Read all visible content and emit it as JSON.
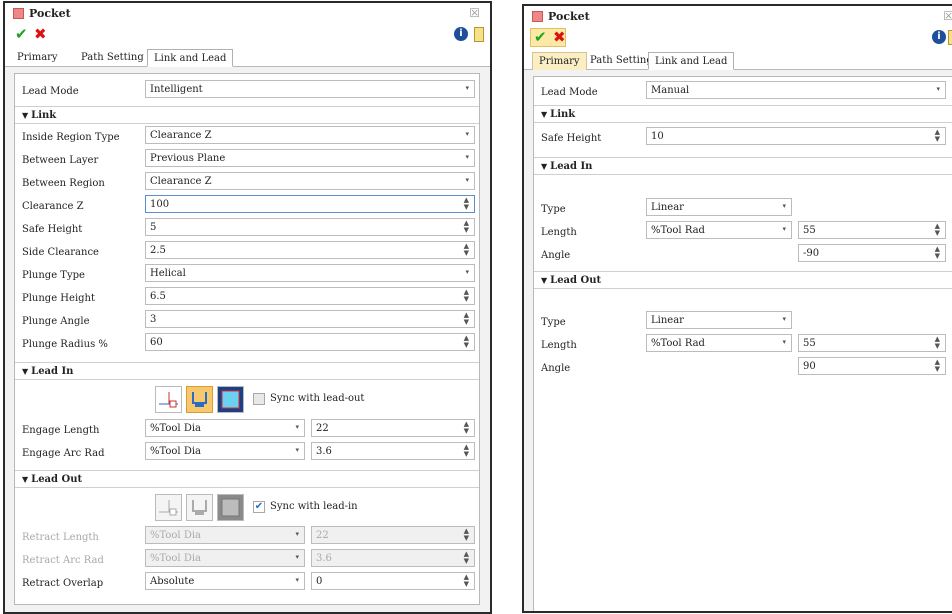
{
  "left": {
    "title": "Pocket",
    "tabs": [
      "Primary",
      "Path Setting",
      "Link and Lead"
    ],
    "lead_mode": {
      "label": "Lead Mode",
      "value": "Intelligent"
    },
    "sections": {
      "link": "Link",
      "lead_in": "Lead In",
      "lead_out": "Lead Out"
    },
    "link_rows": [
      {
        "label": "Inside Region Type",
        "value": "Clearance Z"
      },
      {
        "label": "Between Layer",
        "value": "Previous Plane"
      },
      {
        "label": "Between Region",
        "value": "Clearance Z"
      },
      {
        "label": "Clearance Z",
        "value": "100"
      },
      {
        "label": "Safe Height",
        "value": "5"
      },
      {
        "label": "Side Clearance",
        "value": "2.5"
      },
      {
        "label": "Plunge Type",
        "value": "Helical"
      },
      {
        "label": "Plunge Height",
        "value": "6.5"
      },
      {
        "label": "Plunge Angle",
        "value": "3"
      },
      {
        "label": "Plunge Radius %",
        "value": "60"
      }
    ],
    "lead_in": {
      "sync_label": "Sync with lead-out",
      "sync_checked": false,
      "rows": [
        {
          "label": "Engage Length",
          "mode": "%Tool Dia",
          "value": "22"
        },
        {
          "label": "Engage Arc Rad",
          "mode": "%Tool Dia",
          "value": "3.6"
        }
      ]
    },
    "lead_out": {
      "sync_label": "Sync with lead-in",
      "sync_checked": true,
      "rows": [
        {
          "label": "Retract Length",
          "mode": "%Tool Dia",
          "value": "22"
        },
        {
          "label": "Retract Arc Rad",
          "mode": "%Tool Dia",
          "value": "3.6"
        },
        {
          "label": "Retract Overlap",
          "mode": "Absolute",
          "value": "0"
        }
      ]
    }
  },
  "right": {
    "title": "Pocket",
    "tabs": [
      "Primary",
      "Path Setting",
      "Link and Lead"
    ],
    "lead_mode": {
      "label": "Lead Mode",
      "value": "Manual"
    },
    "sections": {
      "link": "Link",
      "lead_in": "Lead In",
      "lead_out": "Lead Out"
    },
    "safe_height": {
      "label": "Safe Height",
      "value": "10"
    },
    "lead_in": {
      "type": {
        "label": "Type",
        "value": "Linear"
      },
      "length": {
        "label": "Length",
        "mode": "%Tool Rad",
        "value": "55"
      },
      "angle": {
        "label": "Angle",
        "value": "-90"
      }
    },
    "lead_out": {
      "type": {
        "label": "Type",
        "value": "Linear"
      },
      "length": {
        "label": "Length",
        "mode": "%Tool Rad",
        "value": "55"
      },
      "angle": {
        "label": "Angle",
        "value": "90"
      }
    }
  },
  "icons": {
    "ok": "✔",
    "cancel": "✖",
    "info": "i",
    "close": "☒",
    "dropdown": "▾",
    "section_open": "▼",
    "spin": "▲▼"
  }
}
